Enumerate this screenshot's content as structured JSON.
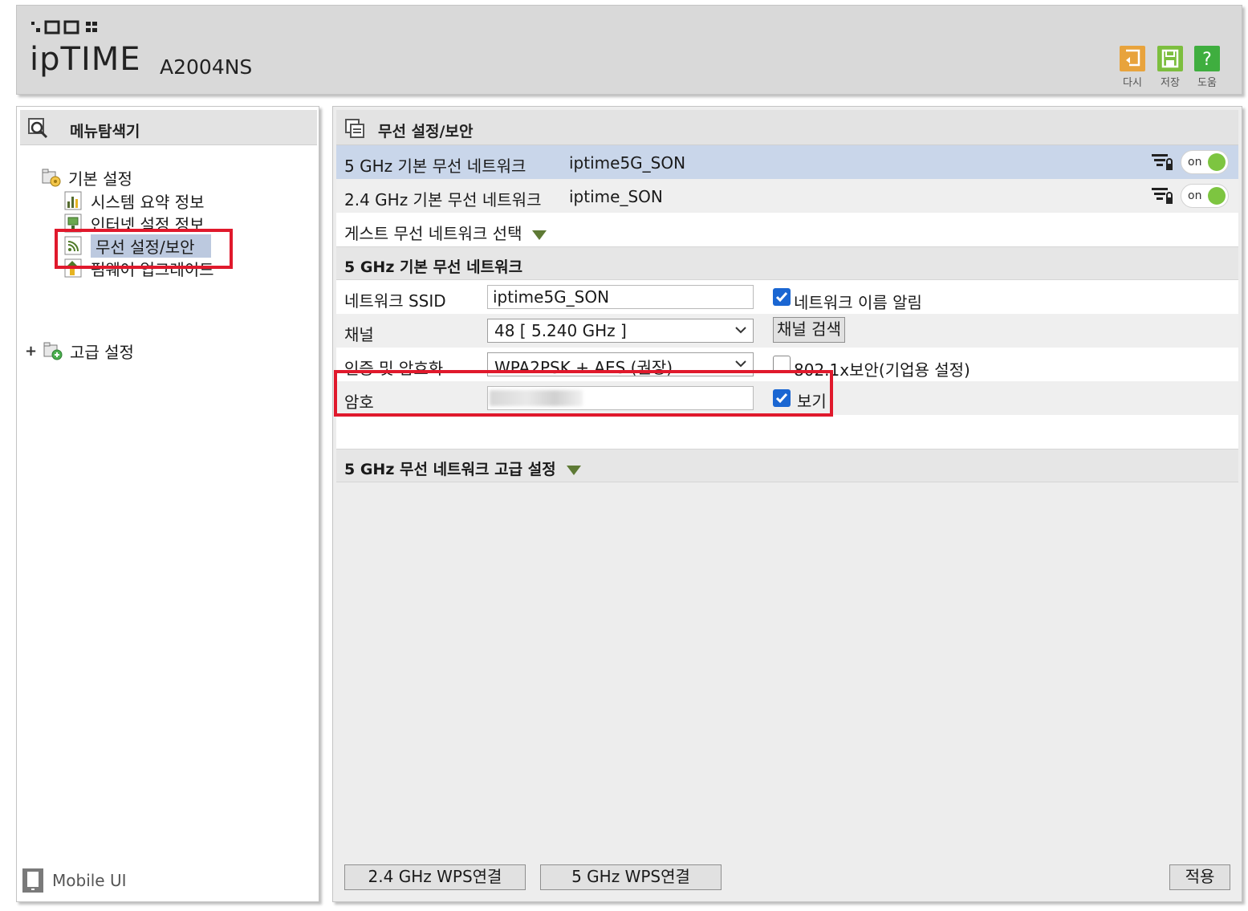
{
  "header": {
    "brand": "ipTIME",
    "model": "A2004NS",
    "tools": [
      {
        "label": "다시",
        "icon": "restart-icon"
      },
      {
        "label": "저장",
        "icon": "save-icon"
      },
      {
        "label": "도움",
        "icon": "help-icon"
      }
    ]
  },
  "sidebar": {
    "title": "메뉴탐색기",
    "groups": [
      {
        "label": "기본 설정",
        "items": [
          {
            "label": "시스템 요약 정보"
          },
          {
            "label": "인터넷 설정 정보"
          },
          {
            "label": "무선 설정/보안",
            "selected": true
          },
          {
            "label": "펌웨어 업그레이드"
          }
        ]
      },
      {
        "label": "고급 설정",
        "expand": "+"
      }
    ],
    "mobile_ui": "Mobile UI"
  },
  "main": {
    "title": "무선 설정/보안",
    "networks": [
      {
        "name": "5 GHz 기본 무선 네트워크",
        "ssid": "iptime5G_SON",
        "toggle": "on"
      },
      {
        "name": "2.4 GHz 기본 무선 네트워크",
        "ssid": "iptime_SON",
        "toggle": "on"
      }
    ],
    "guest_select": "게스트 무선 네트워크 선택",
    "section_basic": "5 GHz 기본 무선 네트워크",
    "form": {
      "ssid_label": "네트워크 SSID",
      "ssid_value": "iptime5G_SON",
      "broadcast_label": "네트워크 이름 알림",
      "broadcast_checked": true,
      "channel_label": "채널",
      "channel_value": "48 [ 5.240 GHz ]",
      "channel_scan_button": "채널 검색",
      "auth_label": "인증 및 암호화",
      "auth_value": "WPA2PSK + AES (권장)",
      "enterprise_label": "802.1x보안(기업용 설정)",
      "enterprise_checked": false,
      "password_label": "암호",
      "show_label": "보기",
      "show_checked": true
    },
    "section_advanced": "5 GHz 무선 네트워크 고급 설정",
    "buttons": {
      "wps24": "2.4 GHz WPS연결",
      "wps5": "5 GHz WPS연결",
      "apply": "적용"
    }
  },
  "colors": {
    "highlight_row": "#c9d6ea",
    "toggle_on": "#7dc540",
    "annotation_red": "#e0192c",
    "checkbox_blue": "#1a66d2"
  }
}
